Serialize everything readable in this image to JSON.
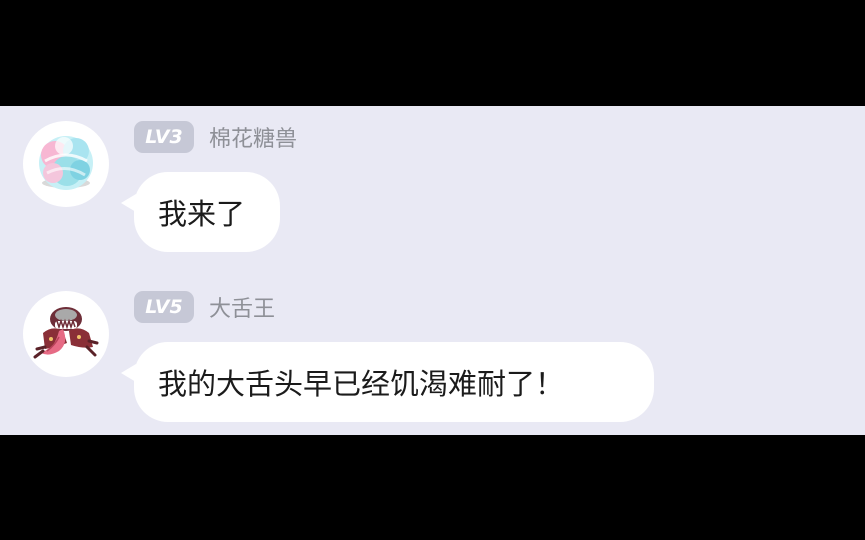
{
  "messages": [
    {
      "level": "LV3",
      "username": "棉花糖兽",
      "text": "我来了",
      "avatar_icon": "cotton-candy-monster-icon"
    },
    {
      "level": "LV5",
      "username": "大舌王",
      "text": "我的大舌头早已经饥渴难耐了！",
      "avatar_icon": "big-tongue-monster-icon"
    }
  ],
  "colors": {
    "background": "#e9e9f4",
    "bubble": "#ffffff",
    "badge": "#c6c8d6",
    "username": "#8e9097",
    "letterbox": "#000000"
  }
}
